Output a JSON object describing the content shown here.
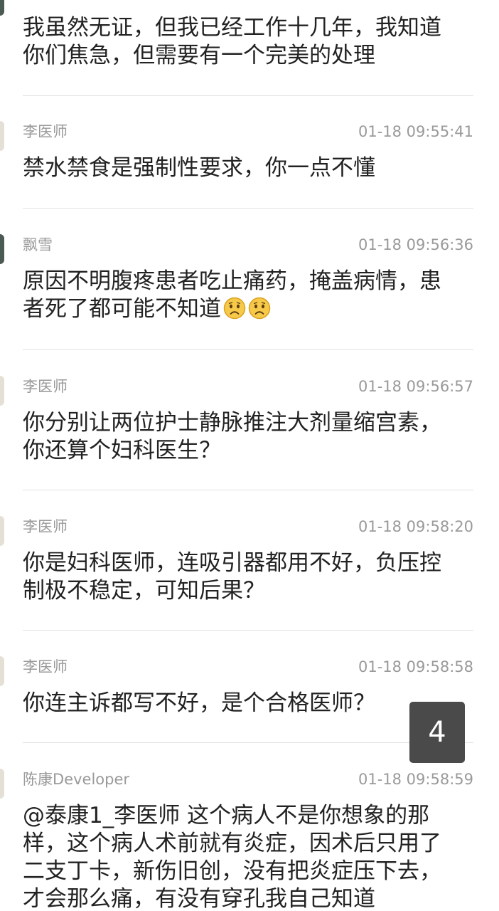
{
  "comments": [
    {
      "author": "",
      "time": "",
      "lines": [
        "我虽然无证，但我已经工作十几年，我知道",
        "你们焦急，但需要有一个完美的处理"
      ]
    },
    {
      "author": "李医师",
      "time": "01-18 09:55:41",
      "lines": [
        "禁水禁食是强制性要求，你一点不懂"
      ]
    },
    {
      "author": "飘雪",
      "time": "01-18 09:56:36",
      "lines": [
        "原因不明腹疼患者吃止痛药，掩盖病情，患",
        "者死了都可能不知道"
      ],
      "emojis": [
        "sad-face-emoji",
        "sad-face-emoji"
      ]
    },
    {
      "author": "李医师",
      "time": "01-18 09:56:57",
      "lines": [
        "你分别让两位护士静脉推注大剂量缩宫素，",
        "你还算个妇科医生？"
      ]
    },
    {
      "author": "李医师",
      "time": "01-18 09:58:20",
      "lines": [
        "你是妇科医师，连吸引器都用不好，负压控",
        "制极不稳定，可知后果？"
      ]
    },
    {
      "author": "李医师",
      "time": "01-18 09:58:58",
      "lines": [
        "你连主诉都写不好，是个合格医师？"
      ]
    },
    {
      "author": "陈康Developer",
      "time": "01-18 09:58:59",
      "lines": [
        "@泰康1_李医师 这个病人不是你想象的那",
        "样，这个病人术前就有炎症，因术后只用了",
        "二支丁卡，新伤旧创，没有把炎症压下去，",
        "才会那么痛，有没有穿孔我自己知道"
      ]
    }
  ],
  "page_badge": "4",
  "colors": {
    "meta_text": "#9a9a9a",
    "body_text": "#222222",
    "separator": "#e2e2e2",
    "badge_bg": "#4a4a4a",
    "emoji_face": "#f7c948"
  }
}
